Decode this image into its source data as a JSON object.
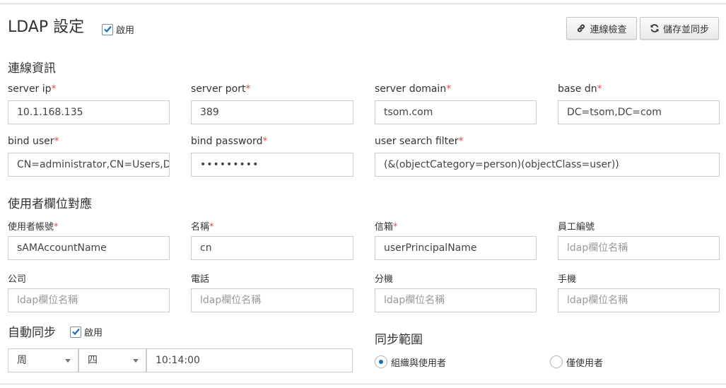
{
  "header": {
    "title": "LDAP 設定",
    "enable_label": "啟用",
    "enable_checked": true,
    "test_button": "連線檢查",
    "save_sync_button": "儲存並同步"
  },
  "connection": {
    "section_title": "連線資訊",
    "required_mark": "*",
    "server_ip": {
      "label": "server ip",
      "value": "10.1.168.135"
    },
    "server_port": {
      "label": "server port",
      "value": "389"
    },
    "server_domain": {
      "label": "server domain",
      "value": "tsom.com"
    },
    "base_dn": {
      "label": "base dn",
      "value": "DC=tsom,DC=com"
    },
    "bind_user": {
      "label": "bind user",
      "value": "CN=administrator,CN=Users,DC=tsom,DC=com"
    },
    "bind_password": {
      "label": "bind password",
      "value": "•••••••••"
    },
    "user_search_filter": {
      "label": "user search filter",
      "value": "(&(objectCategory=person)(objectClass=user))"
    }
  },
  "mapping": {
    "section_title": "使用者欄位對應",
    "placeholder": "ldap欄位名稱",
    "account": {
      "label": "使用者帳號",
      "value": "sAMAccountName"
    },
    "name": {
      "label": "名稱",
      "value": "cn"
    },
    "email": {
      "label": "信箱",
      "value": "userPrincipalName"
    },
    "employee_id": {
      "label": "員工編號",
      "value": ""
    },
    "company": {
      "label": "公司",
      "value": ""
    },
    "phone": {
      "label": "電話",
      "value": ""
    },
    "extension": {
      "label": "分機",
      "value": ""
    },
    "mobile": {
      "label": "手機",
      "value": ""
    }
  },
  "auto_sync": {
    "section_title": "自動同步",
    "enable_label": "啟用",
    "enable_checked": true,
    "period_value": "周",
    "weekday_value": "四",
    "time_value": "10:14:00"
  },
  "sync_scope": {
    "section_title": "同步範圍",
    "options": [
      {
        "label": "組織與使用者",
        "selected": true
      },
      {
        "label": "僅使用者",
        "selected": false
      }
    ]
  },
  "colors": {
    "accent": "#1a6fb0",
    "required": "#d9534f",
    "border": "#cccccc",
    "divider": "#c9d4dc"
  }
}
